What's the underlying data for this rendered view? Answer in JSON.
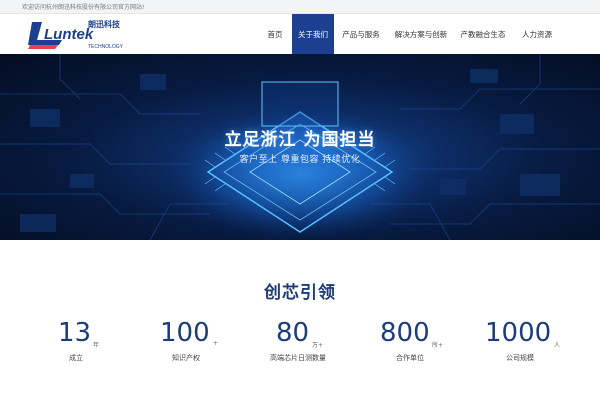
{
  "topbar": {
    "welcome": "欢迎访问杭州朗迅科技股份有限公司官方网站!"
  },
  "logo": {
    "cn": "朗迅科技",
    "en": "Luntek",
    "sub": "TECHNOLOGY"
  },
  "nav": {
    "items": [
      {
        "label": "首页"
      },
      {
        "label": "关于我们"
      },
      {
        "label": "产品与服务"
      },
      {
        "label": "解决方案与创新"
      },
      {
        "label": "产教融合生态"
      },
      {
        "label": "人力资源"
      }
    ]
  },
  "hero": {
    "title": "立足浙江 为国担当",
    "subtitle": "客户至上 尊重包容 持续优化"
  },
  "section": {
    "title": "创芯引领"
  },
  "stats": [
    {
      "value": "13",
      "unit": "年",
      "label": "成立"
    },
    {
      "value": "100",
      "unit": "+",
      "label": "知识产权"
    },
    {
      "value": "80",
      "unit": "万+",
      "label": "高端芯片日测数量"
    },
    {
      "value": "800",
      "unit": "所+",
      "label": "合作单位"
    },
    {
      "value": "1000",
      "unit": "人",
      "label": "公司规模"
    }
  ],
  "colors": {
    "brand": "#1d3f8f",
    "statBlue": "#1d3c7a"
  }
}
